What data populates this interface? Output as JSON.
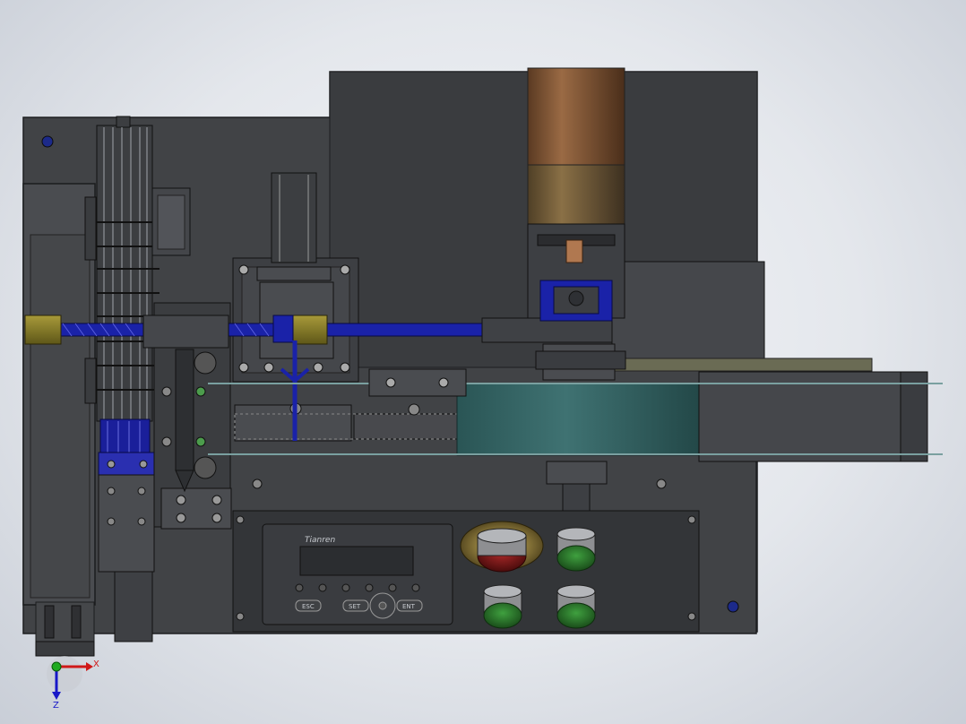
{
  "panel": {
    "brand": "Tianren",
    "keys": {
      "esc": "ESC",
      "set": "SET",
      "ent": "ENT"
    }
  },
  "triad": {
    "x_label": "X",
    "z_label": "Z"
  },
  "colors": {
    "background": "#e6e9ee",
    "frame": "#3d3f42",
    "screw_blue": "#1e24a8",
    "brass": "#8a7f2a",
    "motor_copper": "#7d5332",
    "motor_bronze": "#6c5838",
    "belt_teal": "#2e5a5a",
    "button_green": "#2b7a2b",
    "button_red": "#8a1b1b"
  }
}
